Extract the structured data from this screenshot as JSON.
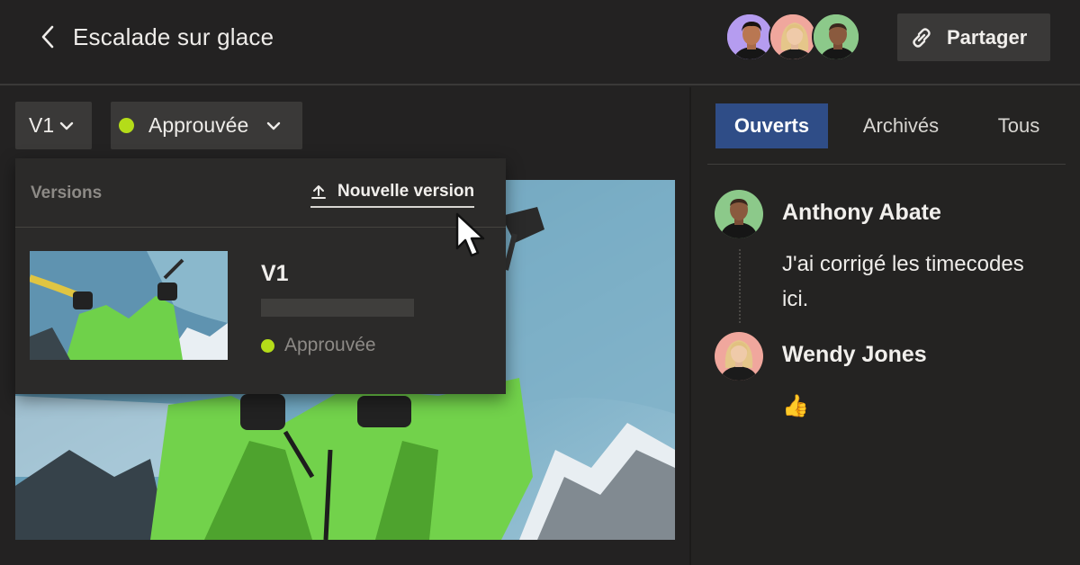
{
  "header": {
    "title": "Escalade sur glace",
    "share_label": "Partager",
    "collaborators": [
      "avatar-1",
      "avatar-2",
      "avatar-3"
    ]
  },
  "toolbar": {
    "version_label": "V1",
    "status_label": "Approuvée",
    "status_color": "#b4dc19"
  },
  "versions_menu": {
    "title": "Versions",
    "new_version_label": "Nouvelle version",
    "items": [
      {
        "name": "V1",
        "status": "Approuvée"
      }
    ]
  },
  "comments_panel": {
    "tabs": [
      {
        "label": "Ouverts",
        "active": true
      },
      {
        "label": "Archivés",
        "active": false
      },
      {
        "label": "Tous",
        "active": false
      }
    ],
    "comments": [
      {
        "author": "Anthony Abate",
        "text": "J'ai corrigé les timecodes ici."
      },
      {
        "author": "Wendy Jones",
        "text": "👍"
      }
    ]
  },
  "colors": {
    "background": "#232222",
    "panel": "#2b2a29",
    "control": "#3a3938",
    "accent_tab": "#2f4d87",
    "approved": "#b4dc19"
  }
}
